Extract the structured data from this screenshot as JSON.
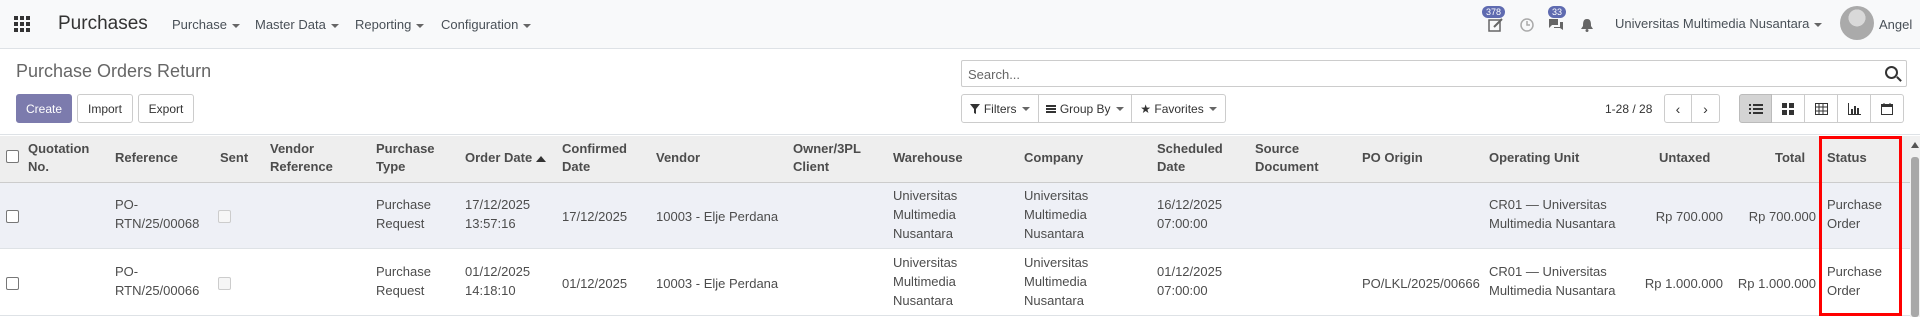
{
  "navbar": {
    "app": "Purchases",
    "menus": [
      "Purchase",
      "Master Data",
      "Reporting",
      "Configuration"
    ],
    "activity_count": "378",
    "message_count": "33",
    "company": "Universitas Multimedia Nusantara",
    "user": "Angel"
  },
  "page": {
    "title": "Purchase Orders Return",
    "create": "Create",
    "import": "Import",
    "export": "Export"
  },
  "search": {
    "placeholder": "Search..."
  },
  "filters": {
    "filters": "Filters",
    "group_by": "Group By",
    "favorites": "Favorites"
  },
  "pager": {
    "value": "1-28 / 28"
  },
  "table": {
    "headers": {
      "quotation_no": [
        "Quotation",
        "No."
      ],
      "reference": "Reference",
      "sent": "Sent",
      "vendor_reference": [
        "Vendor",
        "Reference"
      ],
      "purchase_type": [
        "Purchase",
        "Type"
      ],
      "order_date": "Order Date",
      "confirmed_date": [
        "Confirmed",
        "Date"
      ],
      "vendor": "Vendor",
      "owner": [
        "Owner/3PL",
        "Client"
      ],
      "warehouse": "Warehouse",
      "company": "Company",
      "scheduled_date": [
        "Scheduled",
        "Date"
      ],
      "source_document": [
        "Source",
        "Document"
      ],
      "po_origin": "PO Origin",
      "operating_unit": "Operating Unit",
      "untaxed": "Untaxed",
      "total": "Total",
      "status": "Status"
    },
    "rows": [
      {
        "reference": [
          "PO-",
          "RTN/25/00068"
        ],
        "purchase_type": [
          "Purchase",
          "Request"
        ],
        "order_date": [
          "17/12/2025",
          "13:57:16"
        ],
        "confirmed_date": "17/12/2025",
        "vendor": "10003 - Elje Perdana",
        "warehouse": [
          "Universitas",
          "Multimedia",
          "Nusantara"
        ],
        "company": [
          "Universitas",
          "Multimedia",
          "Nusantara"
        ],
        "scheduled_date": [
          "16/12/2025",
          "07:00:00"
        ],
        "po_origin": "",
        "operating_unit": [
          "CR01 — Universitas",
          "Multimedia Nusantara"
        ],
        "untaxed": "Rp 700.000",
        "total": "Rp 700.000",
        "status": [
          "Purchase",
          "Order"
        ]
      },
      {
        "reference": [
          "PO-",
          "RTN/25/00066"
        ],
        "purchase_type": [
          "Purchase",
          "Request"
        ],
        "order_date": [
          "01/12/2025",
          "14:18:10"
        ],
        "confirmed_date": "01/12/2025",
        "vendor": "10003 - Elje Perdana",
        "warehouse": [
          "Universitas",
          "Multimedia",
          "Nusantara"
        ],
        "company": [
          "Universitas",
          "Multimedia",
          "Nusantara"
        ],
        "scheduled_date": [
          "01/12/2025",
          "07:00:00"
        ],
        "po_origin": "PO/LKL/2025/00666",
        "operating_unit": [
          "CR01 — Universitas",
          "Multimedia Nusantara"
        ],
        "untaxed": "Rp 1.000.000",
        "total": "Rp 1.000.000",
        "status": [
          "Purchase",
          "Order"
        ]
      }
    ]
  }
}
